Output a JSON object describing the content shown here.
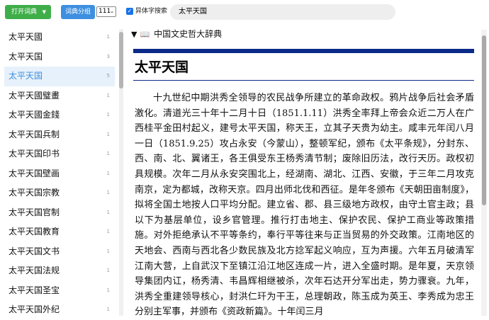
{
  "toolbar": {
    "open_dict_label": "打开词典",
    "dict_group_label": "词典分组",
    "group_select_value": "111",
    "variant_search_label": "异体字搜索",
    "search_value": "太平天国"
  },
  "sidebar": {
    "items": [
      {
        "label": "太平天國",
        "count": "1"
      },
      {
        "label": "太平天国",
        "count": "3"
      },
      {
        "label": "太平天国",
        "count": "5"
      },
      {
        "label": "太平天國璧畫",
        "count": "1"
      },
      {
        "label": "太平天國金錢",
        "count": "1"
      },
      {
        "label": "太平天国兵制",
        "count": "1"
      },
      {
        "label": "太平天国印书",
        "count": "1"
      },
      {
        "label": "太平天国壁画",
        "count": "1"
      },
      {
        "label": "太平天国宗教",
        "count": "1"
      },
      {
        "label": "太平天国官制",
        "count": "1"
      },
      {
        "label": "太平天国教育",
        "count": "1"
      },
      {
        "label": "太平天国文书",
        "count": "1"
      },
      {
        "label": "太平天国法规",
        "count": "1"
      },
      {
        "label": "太平天国圣宝",
        "count": "1"
      },
      {
        "label": "太平天国外纪",
        "count": "1"
      }
    ]
  },
  "article": {
    "dict_name": "中国文史哲大辞典",
    "title": "太平天国",
    "body": "十九世纪中期洪秀全领导的农民战争所建立的革命政权。鸦片战争后社会矛盾激化。清道光三十年十二月十日（1851.1.11）洪秀全率拜上帝会众近二万人在广西桂平金田村起义，建号太平天国，称天王，立其子天贵为幼主。咸丰元年闰八月一日（1851.9.25）攻占永安（今蒙山），整顿军纪，颁布《太平条规》，分封东、西、南、北、翼诸王，各王俱受东王杨秀清节制；废除旧历法，改行天历。政权初具规模。次年二月从永安突围北上，经湖南、湖北、江西、安徽，于三年二月攻克南京，定为都城，改称天京。四月出师北伐和西征。是年冬颁布《天朝田亩制度》，拟将全国土地按人口平均分配。建立省、郡、县三级地方政权，由守土官主政；县以下为基层单位，设乡官管理。推行打击地主、保护农民、保护工商业等政策措施。对外拒绝承认不平等条约，奉行平等往来与正当贸易的外交政策。江南地区的天地会、西南与西北各少数民族及北方捻军起义响应，互为声援。六年五月破清军江南大营，上自武汉下至镇江沿江地区连成一片，进入全盛时期。是年夏，天京领导集团内讧，杨秀清、韦昌辉相继被杀，次年石达开分军出走，势力骤衰。九年，洪秀全重建领导核心，封洪仁玕为干王，总理朝政，陈玉成为英王、李秀成为忠王分别主军事，并颁布《资政新篇》。十年闰三月"
  },
  "colors": {
    "green": "#3fae49",
    "blue": "#3d8fe0",
    "navy_rule": "#0b2a88",
    "selected_bg": "#e7f1fb"
  }
}
